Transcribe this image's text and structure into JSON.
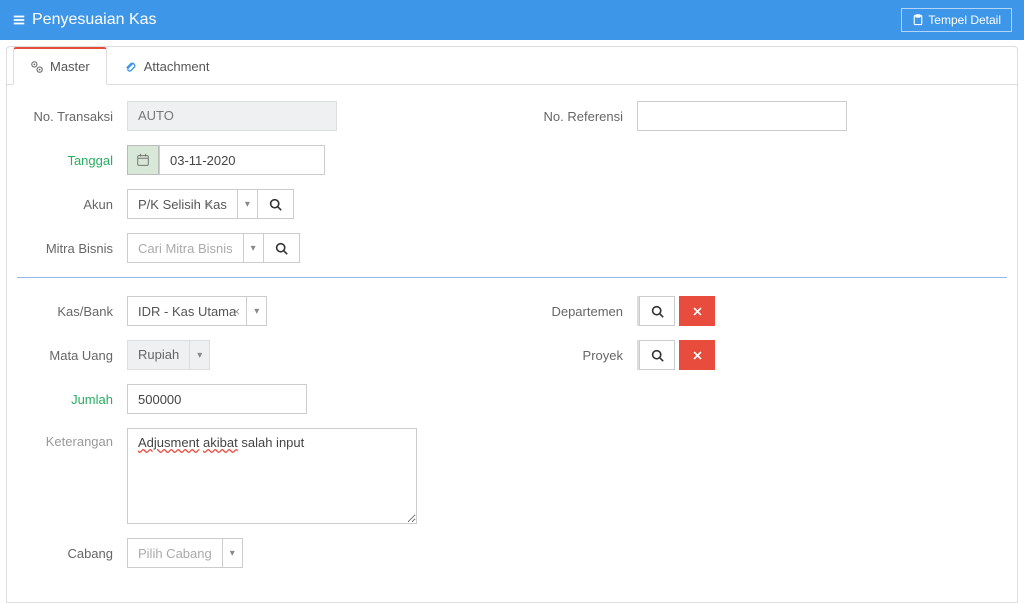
{
  "header": {
    "title": "Penyesuaian Kas",
    "action_button": "Tempel Detail"
  },
  "tabs": {
    "master": "Master",
    "attachment": "Attachment"
  },
  "form": {
    "labels": {
      "no_transaksi": "No. Transaksi",
      "no_referensi": "No. Referensi",
      "tanggal": "Tanggal",
      "akun": "Akun",
      "mitra_bisnis": "Mitra Bisnis",
      "kas_bank": "Kas/Bank",
      "departemen": "Departemen",
      "mata_uang": "Mata Uang",
      "proyek": "Proyek",
      "jumlah": "Jumlah",
      "keterangan": "Keterangan",
      "cabang": "Cabang"
    },
    "values": {
      "no_transaksi": "AUTO",
      "no_referensi": "",
      "tanggal": "03-11-2020",
      "akun": "P/K Selisih Kas",
      "mitra_bisnis_placeholder": "Cari Mitra Bisnis",
      "kas_bank": "IDR - Kas Utama",
      "mata_uang": "Rupiah",
      "jumlah": "500000",
      "keterangan_word1": "Adjusment",
      "keterangan_word2": "akibat",
      "keterangan_rest": " salah input",
      "cabang_placeholder": "Pilih Cabang"
    }
  }
}
